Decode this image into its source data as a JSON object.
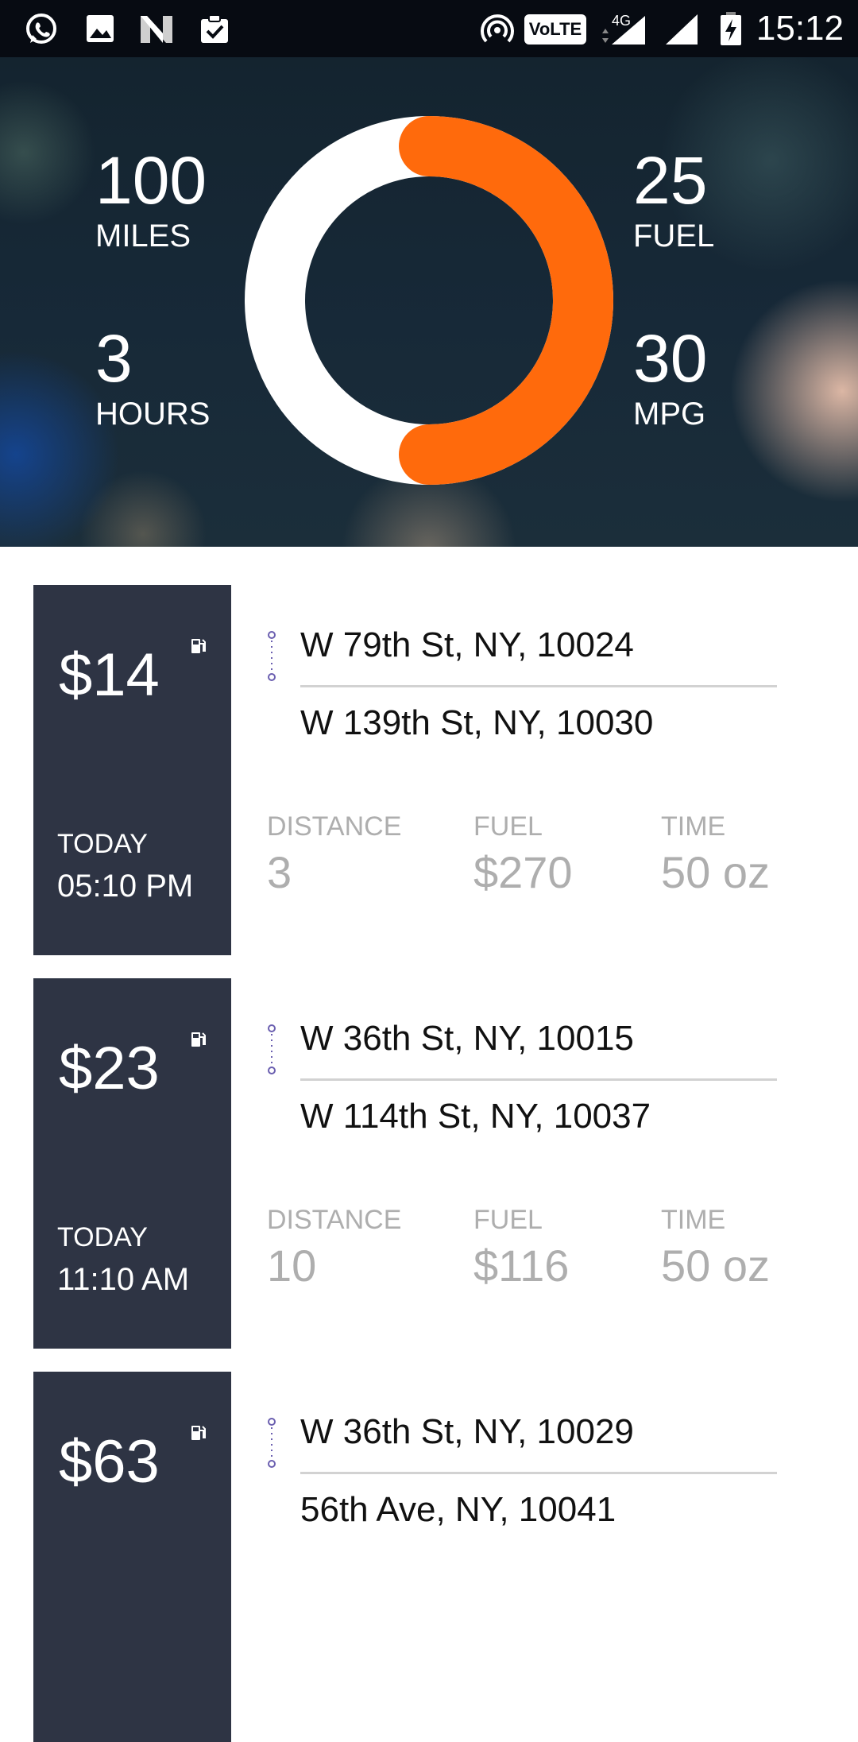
{
  "status_bar": {
    "time": "15:12",
    "volte_label": "VoLTE",
    "network_label": "4G",
    "icons": [
      "whatsapp-icon",
      "gallery-icon",
      "n-icon",
      "clipboard-check-icon",
      "hotspot-icon",
      "volte-icon",
      "signal-4g-icon",
      "signal-icon",
      "battery-charging-icon"
    ]
  },
  "summary": {
    "miles": {
      "value": "100",
      "label": "MILES"
    },
    "hours": {
      "value": "3",
      "label": "HOURS"
    },
    "fuel": {
      "value": "25",
      "label": "FUEL"
    },
    "mpg": {
      "value": "30",
      "label": "MPG"
    },
    "ring_progress": 0.5,
    "ring_color_progress": "#ff6a0c",
    "ring_color_track": "#ffffff"
  },
  "trips": [
    {
      "price": "$14",
      "when": "TODAY",
      "time": "05:10 PM",
      "from": "W 79th St, NY, 10024",
      "to": "W 139th St, NY, 10030",
      "metrics": [
        {
          "label": "DISTANCE",
          "value": "3"
        },
        {
          "label": "FUEL",
          "value": "$270"
        },
        {
          "label": "TIME",
          "value": "50 oz"
        }
      ]
    },
    {
      "price": "$23",
      "when": "TODAY",
      "time": "11:10 AM",
      "from": "W 36th St, NY, 10015",
      "to": "W 114th St, NY, 10037",
      "metrics": [
        {
          "label": "DISTANCE",
          "value": "10"
        },
        {
          "label": "FUEL",
          "value": "$116"
        },
        {
          "label": "TIME",
          "value": "50 oz"
        }
      ]
    },
    {
      "price": "$63",
      "from": "W 36th St, NY, 10029",
      "to": "56th Ave, NY, 10041"
    }
  ],
  "colors": {
    "card_bg": "#2e3444",
    "accent": "#ff6a0c",
    "route_dot": "#6b5fb0",
    "status_bar_bg": "#070b12"
  }
}
